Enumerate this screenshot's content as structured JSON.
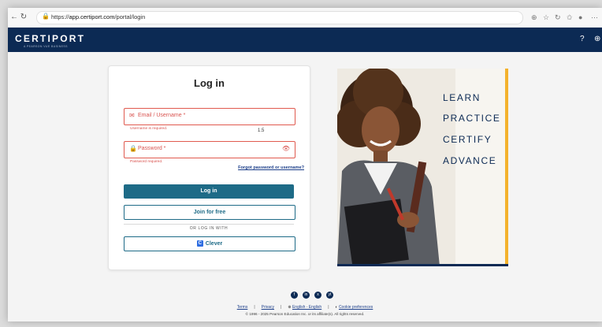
{
  "browser": {
    "url_prefix": "https://",
    "url_host": "app.certiport.com",
    "url_path": "/portal/login"
  },
  "header": {
    "logo": "CERTIPORT",
    "logo_tagline": "A PEARSON VUE BUSINESS"
  },
  "login": {
    "title": "Log in",
    "email_label": "Email / Username *",
    "email_error": "Username is required.",
    "overlay_number": "1.5",
    "password_label": "Password *",
    "password_error": "Password required.",
    "forgot_link": "Forgot password or username?",
    "login_button": "Log in",
    "join_button": "Join for free",
    "or_text": "OR LOG IN WITH",
    "clever_button": "Clever"
  },
  "hero": {
    "words": [
      "LEARN",
      "PRACTICE",
      "CERTIFY",
      "ADVANCE"
    ],
    "accent_color": "#f4b22c",
    "text_color": "#0c2a54"
  },
  "footer": {
    "social": [
      "f",
      "in",
      "x",
      "yt"
    ],
    "terms": "Terms",
    "privacy": "Privacy",
    "language": "English - English",
    "cookies": "Cookie preferences",
    "copyright": "© 1996 - 2025 Pearson Education Inc. or its affiliate(s). All rights reserved."
  },
  "colors": {
    "brand_navy": "#0c2a54",
    "primary_button": "#1e6b87",
    "error": "#d9534f"
  }
}
